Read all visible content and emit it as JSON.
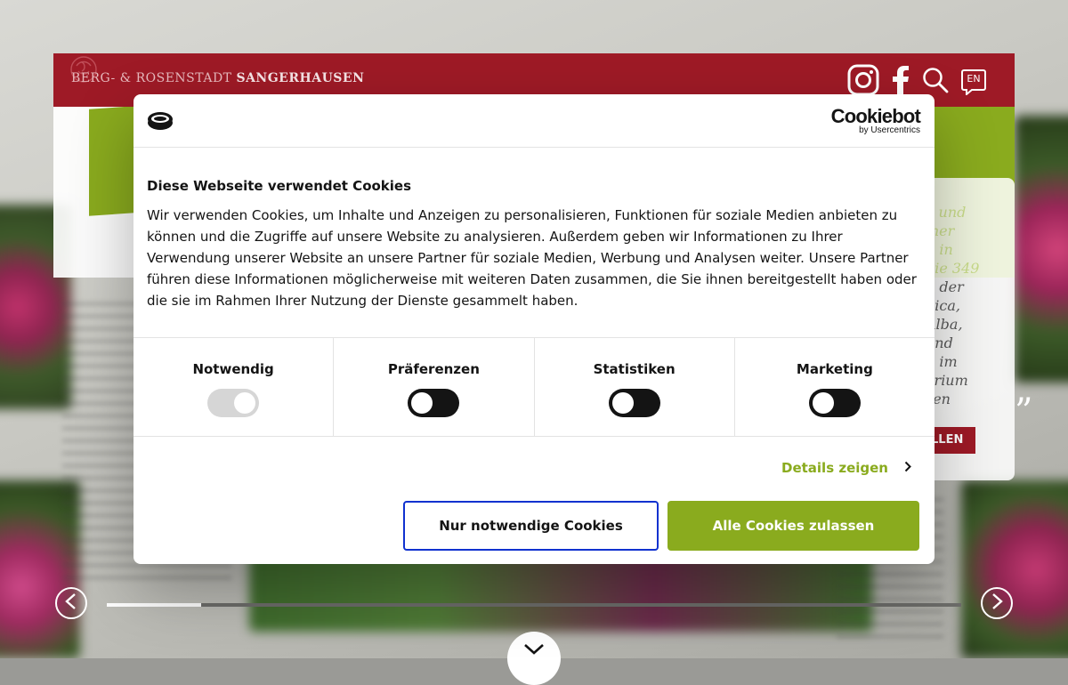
{
  "site": {
    "title_prefix": "BERG- & ROSENSTADT ",
    "title_bold": "SANGERHAUSEN",
    "language_button": "EN",
    "right_text_lines": [
      "e und",
      "mer",
      "n in",
      "die 349",
      "n der",
      "llica,",
      "Alba,",
      "und",
      "n im",
      "arium",
      "sen"
    ],
    "red_button_label": "LLEN",
    "quote_mark": "”",
    "slider_progress": 0.11,
    "brand_red": "#9e1a26",
    "brand_green": "#8aab1e"
  },
  "header_icons": [
    "instagram-icon",
    "facebook-icon",
    "search-icon",
    "language-icon"
  ],
  "cookie_dialog": {
    "brand_name": "Cookiebot",
    "brand_sub": "by Usercentrics",
    "title": "Diese Webseite verwendet Cookies",
    "text": "Wir verwenden Cookies, um Inhalte und Anzeigen zu personalisieren, Funktionen für soziale Medien anbieten zu können und die Zugriffe auf unsere Website zu analysieren. Außerdem geben wir Informationen zu Ihrer Verwendung unserer Website an unsere Partner für soziale Medien, Werbung und Analysen weiter. Unsere Partner führen diese Informationen möglicherweise mit weiteren Daten zusammen, die Sie ihnen bereitgestellt haben oder die sie im Rahmen Ihrer Nutzung der Dienste gesammelt haben.",
    "toggles": [
      {
        "label": "Notwendig",
        "state": "on-disabled"
      },
      {
        "label": "Präferenzen",
        "state": "off"
      },
      {
        "label": "Statistiken",
        "state": "off"
      },
      {
        "label": "Marketing",
        "state": "off"
      }
    ],
    "details_label": "Details zeigen",
    "btn_necessary": "Nur notwendige Cookies",
    "btn_allow_all": "Alle Cookies zulassen",
    "accent_blue": "#1032cf"
  }
}
